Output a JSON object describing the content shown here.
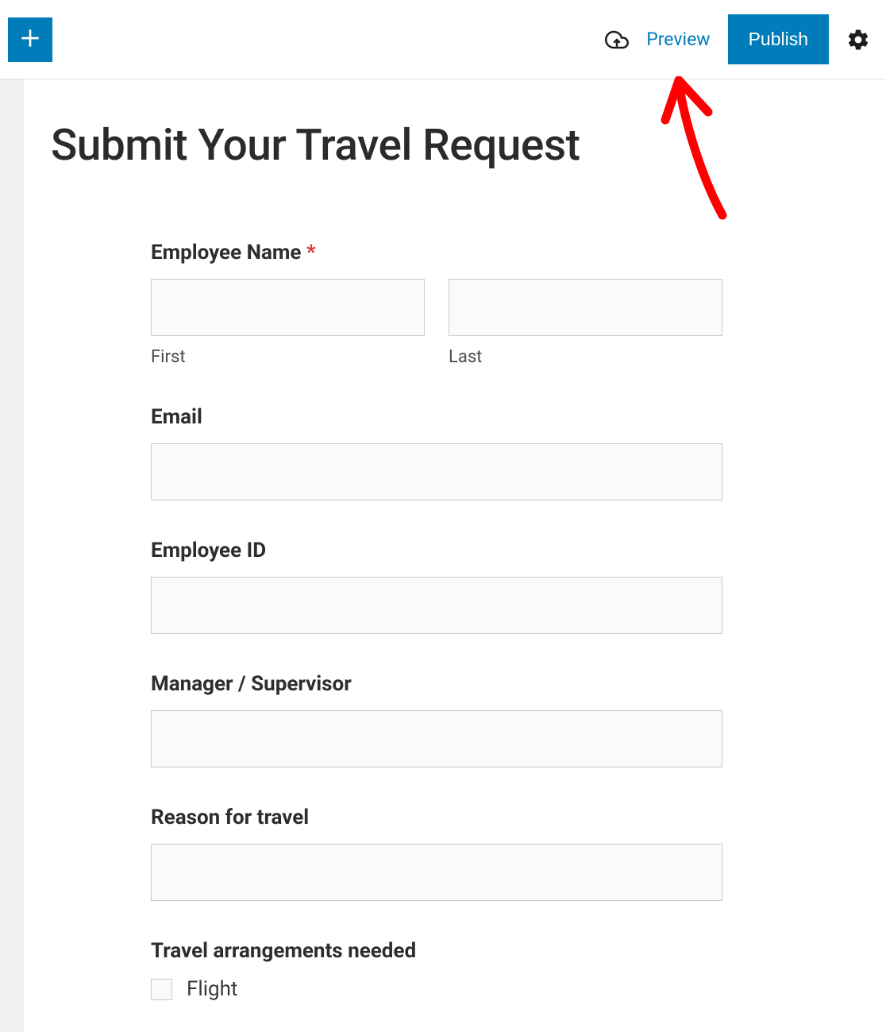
{
  "toolbar": {
    "preview_label": "Preview",
    "publish_label": "Publish"
  },
  "page": {
    "title": "Submit Your Travel Request"
  },
  "form": {
    "employee_name": {
      "label": "Employee Name ",
      "sub_first": "First",
      "sub_last": "Last"
    },
    "email": {
      "label": "Email"
    },
    "employee_id": {
      "label": "Employee ID"
    },
    "manager": {
      "label": "Manager / Supervisor"
    },
    "reason": {
      "label": "Reason for travel"
    },
    "arrangements": {
      "label": "Travel arrangements needed",
      "option_flight": "Flight"
    }
  }
}
